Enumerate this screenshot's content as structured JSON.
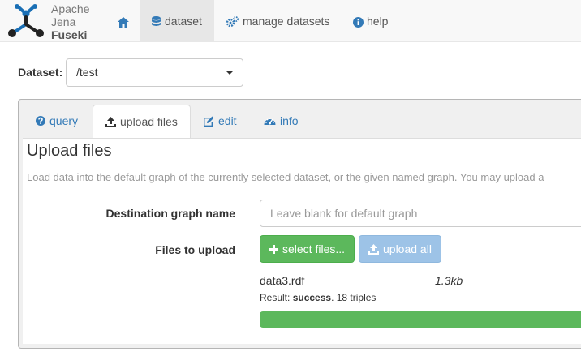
{
  "brand": {
    "line1": "Apache",
    "line2": "Jena",
    "line3": "Fuseki"
  },
  "nav": {
    "home_icon": "home-icon",
    "items": [
      {
        "label": "dataset",
        "icon": "database-icon",
        "active": true
      },
      {
        "label": "manage datasets",
        "icon": "cogs-icon"
      },
      {
        "label": "help",
        "icon": "info-circle-icon"
      }
    ]
  },
  "dataset": {
    "label": "Dataset:",
    "selected": "/test"
  },
  "tabs": [
    {
      "label": "query",
      "icon": "question-circle-icon"
    },
    {
      "label": "upload files",
      "icon": "upload-icon",
      "active": true
    },
    {
      "label": "edit",
      "icon": "edit-icon"
    },
    {
      "label": "info",
      "icon": "dashboard-icon"
    }
  ],
  "upload": {
    "title": "Upload files",
    "description": "Load data into the default graph of the currently selected dataset, or the given named graph. You may upload a",
    "dest_label": "Destination graph name",
    "dest_placeholder": "Leave blank for default graph",
    "files_label": "Files to upload",
    "select_button": "select files...",
    "upload_all_button": "upload all",
    "file": {
      "name": "data3.rdf",
      "size": "1.3kb",
      "result_prefix": "Result: ",
      "result_status": "success",
      "result_suffix": ". 18 triples",
      "progress": 1.0
    }
  },
  "colors": {
    "link": "#337ab7",
    "success": "#5cb85c",
    "primary_disabled": "#9dc3e7"
  }
}
